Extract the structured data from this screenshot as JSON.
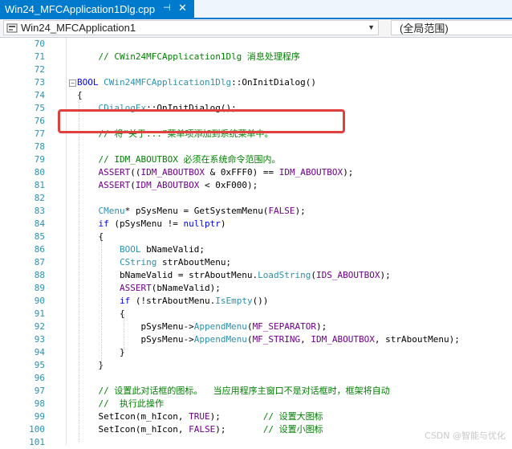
{
  "tab": {
    "title": "Win24_MFCApplication1Dlg.cpp",
    "pin_glyph": "⊣",
    "close_glyph": "✕"
  },
  "nav": {
    "class_combo": "Win24_MFCApplication1",
    "member_combo": "(全局范围)",
    "arrow": "▼"
  },
  "colors": {
    "tab_active": "#007acc",
    "comment": "#008000",
    "keyword": "#0000ff",
    "type": "#2b91af",
    "macro": "#6f008a",
    "line_number": "#2b91af",
    "highlight": "#e0413f"
  },
  "code_lines": [
    {
      "n": "70",
      "fold": "",
      "tokens": []
    },
    {
      "n": "71",
      "fold": "",
      "tokens": [
        [
          "    ",
          "plain"
        ],
        [
          "// CWin24MFCApplication1Dlg 消息处理程序",
          "comment"
        ]
      ]
    },
    {
      "n": "72",
      "fold": "",
      "tokens": []
    },
    {
      "n": "73",
      "fold": "⊟",
      "tokens": [
        [
          "BOOL",
          "keyword"
        ],
        [
          " ",
          "plain"
        ],
        [
          "CWin24MFCApplication1Dlg",
          "type"
        ],
        [
          "::OnInitDialog()",
          "plain"
        ]
      ]
    },
    {
      "n": "74",
      "fold": "",
      "tokens": [
        [
          "{",
          "plain"
        ]
      ]
    },
    {
      "n": "75",
      "fold": "",
      "tokens": [
        [
          "    ",
          "plain"
        ],
        [
          "CDialogEx",
          "type"
        ],
        [
          "::OnInitDialog();",
          "plain"
        ]
      ]
    },
    {
      "n": "76",
      "fold": "",
      "tokens": []
    },
    {
      "n": "77",
      "fold": "",
      "tokens": [
        [
          "    ",
          "plain"
        ],
        [
          "// 将“关于...”菜单项添加到系统菜单中。",
          "comment"
        ]
      ]
    },
    {
      "n": "78",
      "fold": "",
      "tokens": []
    },
    {
      "n": "79",
      "fold": "",
      "tokens": [
        [
          "    ",
          "plain"
        ],
        [
          "// IDM_ABOUTBOX 必须在系统命令范围内。",
          "comment"
        ]
      ]
    },
    {
      "n": "80",
      "fold": "",
      "tokens": [
        [
          "    ",
          "plain"
        ],
        [
          "ASSERT",
          "macro"
        ],
        [
          "((",
          "plain"
        ],
        [
          "IDM_ABOUTBOX",
          "macro"
        ],
        [
          " & 0xFFF0) == ",
          "plain"
        ],
        [
          "IDM_ABOUTBOX",
          "macro"
        ],
        [
          ");",
          "plain"
        ]
      ]
    },
    {
      "n": "81",
      "fold": "",
      "tokens": [
        [
          "    ",
          "plain"
        ],
        [
          "ASSERT",
          "macro"
        ],
        [
          "(",
          "plain"
        ],
        [
          "IDM_ABOUTBOX",
          "macro"
        ],
        [
          " < 0xF000);",
          "plain"
        ]
      ]
    },
    {
      "n": "82",
      "fold": "",
      "tokens": []
    },
    {
      "n": "83",
      "fold": "",
      "tokens": [
        [
          "    ",
          "plain"
        ],
        [
          "CMenu",
          "type"
        ],
        [
          "* pSysMenu = GetSystemMenu(",
          "plain"
        ],
        [
          "FALSE",
          "macro"
        ],
        [
          ");",
          "plain"
        ]
      ]
    },
    {
      "n": "84",
      "fold": "",
      "tokens": [
        [
          "    ",
          "plain"
        ],
        [
          "if",
          "keyword"
        ],
        [
          " (pSysMenu != ",
          "plain"
        ],
        [
          "nullptr",
          "keyword"
        ],
        [
          ")",
          "plain"
        ]
      ]
    },
    {
      "n": "85",
      "fold": "",
      "tokens": [
        [
          "    {",
          "plain"
        ]
      ]
    },
    {
      "n": "86",
      "fold": "",
      "tokens": [
        [
          "        ",
          "plain"
        ],
        [
          "BOOL",
          "type"
        ],
        [
          " bNameValid;",
          "plain"
        ]
      ]
    },
    {
      "n": "87",
      "fold": "",
      "tokens": [
        [
          "        ",
          "plain"
        ],
        [
          "CString",
          "type"
        ],
        [
          " strAboutMenu;",
          "plain"
        ]
      ]
    },
    {
      "n": "88",
      "fold": "",
      "tokens": [
        [
          "        bNameValid = strAboutMenu.",
          "plain"
        ],
        [
          "LoadString",
          "type"
        ],
        [
          "(",
          "plain"
        ],
        [
          "IDS_ABOUTBOX",
          "macro"
        ],
        [
          ");",
          "plain"
        ]
      ]
    },
    {
      "n": "89",
      "fold": "",
      "tokens": [
        [
          "        ",
          "plain"
        ],
        [
          "ASSERT",
          "macro"
        ],
        [
          "(bNameValid);",
          "plain"
        ]
      ]
    },
    {
      "n": "90",
      "fold": "",
      "tokens": [
        [
          "        ",
          "plain"
        ],
        [
          "if",
          "keyword"
        ],
        [
          " (!strAboutMenu.",
          "plain"
        ],
        [
          "IsEmpty",
          "type"
        ],
        [
          "())",
          "plain"
        ]
      ]
    },
    {
      "n": "91",
      "fold": "",
      "tokens": [
        [
          "        {",
          "plain"
        ]
      ]
    },
    {
      "n": "92",
      "fold": "",
      "tokens": [
        [
          "            pSysMenu->",
          "plain"
        ],
        [
          "AppendMenu",
          "type"
        ],
        [
          "(",
          "plain"
        ],
        [
          "MF_SEPARATOR",
          "macro"
        ],
        [
          ");",
          "plain"
        ]
      ]
    },
    {
      "n": "93",
      "fold": "",
      "tokens": [
        [
          "            pSysMenu->",
          "plain"
        ],
        [
          "AppendMenu",
          "type"
        ],
        [
          "(",
          "plain"
        ],
        [
          "MF_STRING",
          "macro"
        ],
        [
          ", ",
          "plain"
        ],
        [
          "IDM_ABOUTBOX",
          "macro"
        ],
        [
          ", strAboutMenu);",
          "plain"
        ]
      ]
    },
    {
      "n": "94",
      "fold": "",
      "tokens": [
        [
          "        }",
          "plain"
        ]
      ]
    },
    {
      "n": "95",
      "fold": "",
      "tokens": [
        [
          "    }",
          "plain"
        ]
      ]
    },
    {
      "n": "96",
      "fold": "",
      "tokens": []
    },
    {
      "n": "97",
      "fold": "",
      "tokens": [
        [
          "    ",
          "plain"
        ],
        [
          "// 设置此对话框的图标。  当应用程序主窗口不是对话框时，框架将自动",
          "comment"
        ]
      ]
    },
    {
      "n": "98",
      "fold": "",
      "tokens": [
        [
          "    ",
          "plain"
        ],
        [
          "//  执行此操作",
          "comment"
        ]
      ]
    },
    {
      "n": "99",
      "fold": "",
      "tokens": [
        [
          "    SetIcon(m_hIcon, ",
          "plain"
        ],
        [
          "TRUE",
          "macro"
        ],
        [
          ");        ",
          "plain"
        ],
        [
          "// 设置大图标",
          "comment"
        ]
      ]
    },
    {
      "n": "100",
      "fold": "",
      "tokens": [
        [
          "    SetIcon(m_hIcon, ",
          "plain"
        ],
        [
          "FALSE",
          "macro"
        ],
        [
          ");       ",
          "plain"
        ],
        [
          "// 设置小图标",
          "comment"
        ]
      ]
    },
    {
      "n": "101",
      "fold": "",
      "tokens": []
    }
  ],
  "watermark": "CSDN @智能与优化"
}
